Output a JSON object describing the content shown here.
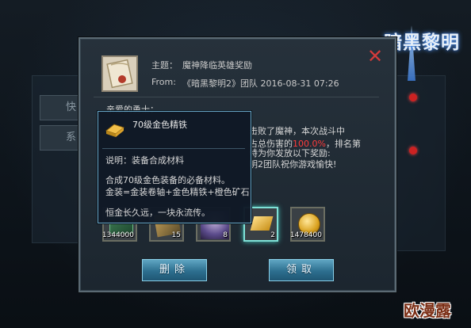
{
  "logo": {
    "text": "暗黑黎明"
  },
  "background": {
    "left_buttons": [
      "快",
      "系"
    ]
  },
  "mail": {
    "subject_label": "主题：",
    "subject": "魔神降临英雄奖励",
    "from_label": "From:",
    "from": "《暗黑黎明2》团队 2016-08-31 07:26",
    "greeting": "亲爱的勇士：",
    "body_lines": [
      "击败了魔神，本次战斗中",
      "占总伤害的",
      "100.0%",
      "，排名第",
      "特为你发放以下奖励:",
      "明2团队祝你游戏愉快!"
    ],
    "rewards": [
      {
        "count": "1344000",
        "icon": "gold-stack-icon"
      },
      {
        "count": "15",
        "icon": "equipment-scroll-icon"
      },
      {
        "count": "8",
        "icon": "hero-portrait-icon"
      },
      {
        "count": "2",
        "icon": "golden-iron-icon",
        "selected": true
      },
      {
        "count": "1478400",
        "icon": "gold-coin-icon"
      }
    ],
    "delete_label": "删除",
    "claim_label": "领取"
  },
  "tooltip": {
    "title": "70级金色精铁",
    "desc": "说明：装备合成材料",
    "line1": "合成70级金色装备的必备材料。",
    "line2": "金装=金装卷轴+金色精铁+橙色矿石",
    "line3": "恒金长久远，一块永流传。"
  },
  "watermark": "欧漫露",
  "colors": {
    "accent": "#5fa5c2",
    "highlight": "#ff3b3b",
    "close": "#d23b3b"
  }
}
